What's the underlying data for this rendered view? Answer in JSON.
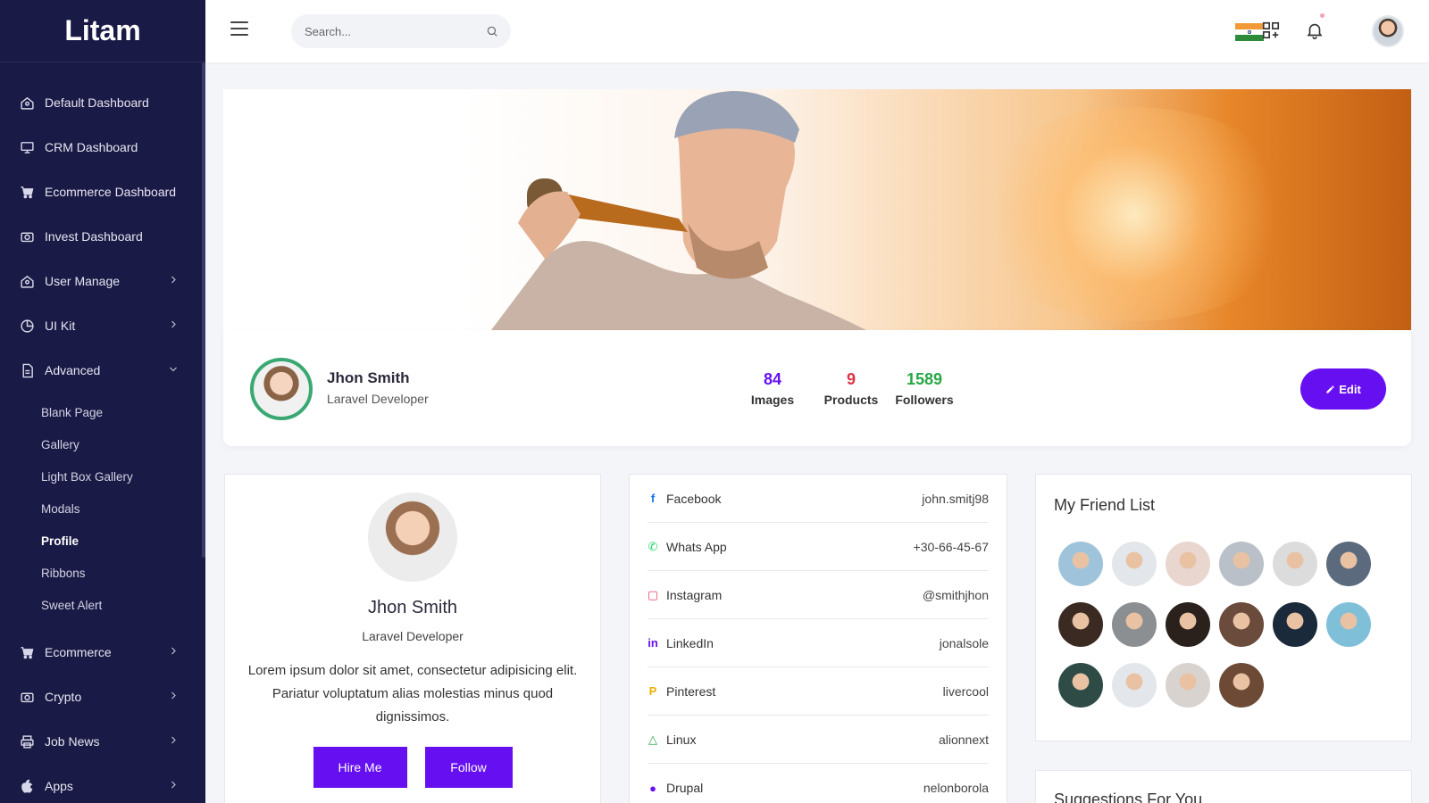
{
  "brand": "Litam",
  "sidebar": {
    "items": [
      {
        "label": "Default Dashboard",
        "icon": "home-icon"
      },
      {
        "label": "CRM Dashboard",
        "icon": "monitor-icon"
      },
      {
        "label": "Ecommerce Dashboard",
        "icon": "cart-icon"
      },
      {
        "label": "Invest Dashboard",
        "icon": "camera-icon"
      },
      {
        "label": "User Manage",
        "icon": "home-icon"
      },
      {
        "label": "UI Kit",
        "icon": "pie-icon"
      },
      {
        "label": "Advanced",
        "icon": "document-icon"
      }
    ],
    "submenu": [
      "Blank Page",
      "Gallery",
      "Light Box Gallery",
      "Modals",
      "Profile",
      "Ribbons",
      "Sweet Alert"
    ],
    "active_sub": "Profile",
    "items_after": [
      {
        "label": "Ecommerce",
        "icon": "cart-icon"
      },
      {
        "label": "Crypto",
        "icon": "camera-icon"
      },
      {
        "label": "Job News",
        "icon": "printer-icon"
      },
      {
        "label": "Apps",
        "icon": "apple-icon"
      }
    ]
  },
  "header": {
    "search_placeholder": "Search..."
  },
  "profile": {
    "name": "Jhon Smith",
    "role": "Laravel Developer",
    "stats": [
      {
        "value": "84",
        "label": "Images",
        "color": "#6610f2"
      },
      {
        "value": "9",
        "label": "Products",
        "color": "#dc3545"
      },
      {
        "value": "1589",
        "label": "Followers",
        "color": "#28a745"
      }
    ],
    "edit_label": "Edit"
  },
  "about": {
    "name": "Jhon Smith",
    "role": "Laravel Developer",
    "bio": "Lorem ipsum dolor sit amet, consectetur adipisicing elit. Pariatur voluptatum alias molestias minus quod dignissimos.",
    "hire_label": "Hire Me",
    "follow_label": "Follow"
  },
  "social": [
    {
      "name": "Facebook",
      "value": "john.smitj98",
      "icon": "facebook-icon",
      "color": "#1877f2"
    },
    {
      "name": "Whats App",
      "value": "+30-66-45-67",
      "icon": "whatsapp-icon",
      "color": "#25d366"
    },
    {
      "name": "Instagram",
      "value": "@smithjhon",
      "icon": "instagram-icon",
      "color": "#e4405f"
    },
    {
      "name": "LinkedIn",
      "value": "jonalsole",
      "icon": "linkedin-icon",
      "color": "#6610f2"
    },
    {
      "name": "Pinterest",
      "value": "livercool",
      "icon": "pinterest-icon",
      "color": "#f0ad00"
    },
    {
      "name": "Linux",
      "value": "alionnext",
      "icon": "linux-icon",
      "color": "#28a745"
    },
    {
      "name": "Drupal",
      "value": "nelonborola",
      "icon": "drupal-icon",
      "color": "#6610f2"
    }
  ],
  "friends": {
    "title": "My Friend List",
    "colors": [
      "#9fc3da",
      "#e3e6ea",
      "#e8d6cf",
      "#b9c0c8",
      "#dcdcdc",
      "#5b6b7d",
      "#3b2a22",
      "#8c8f92",
      "#2a211c",
      "#6b4b3c",
      "#1b2a3a",
      "#7fc0d8",
      "#2f4b45",
      "#e3e6ea",
      "#d9d3cf",
      "#6d4a36"
    ]
  },
  "suggestions_title": "Suggestions For You"
}
